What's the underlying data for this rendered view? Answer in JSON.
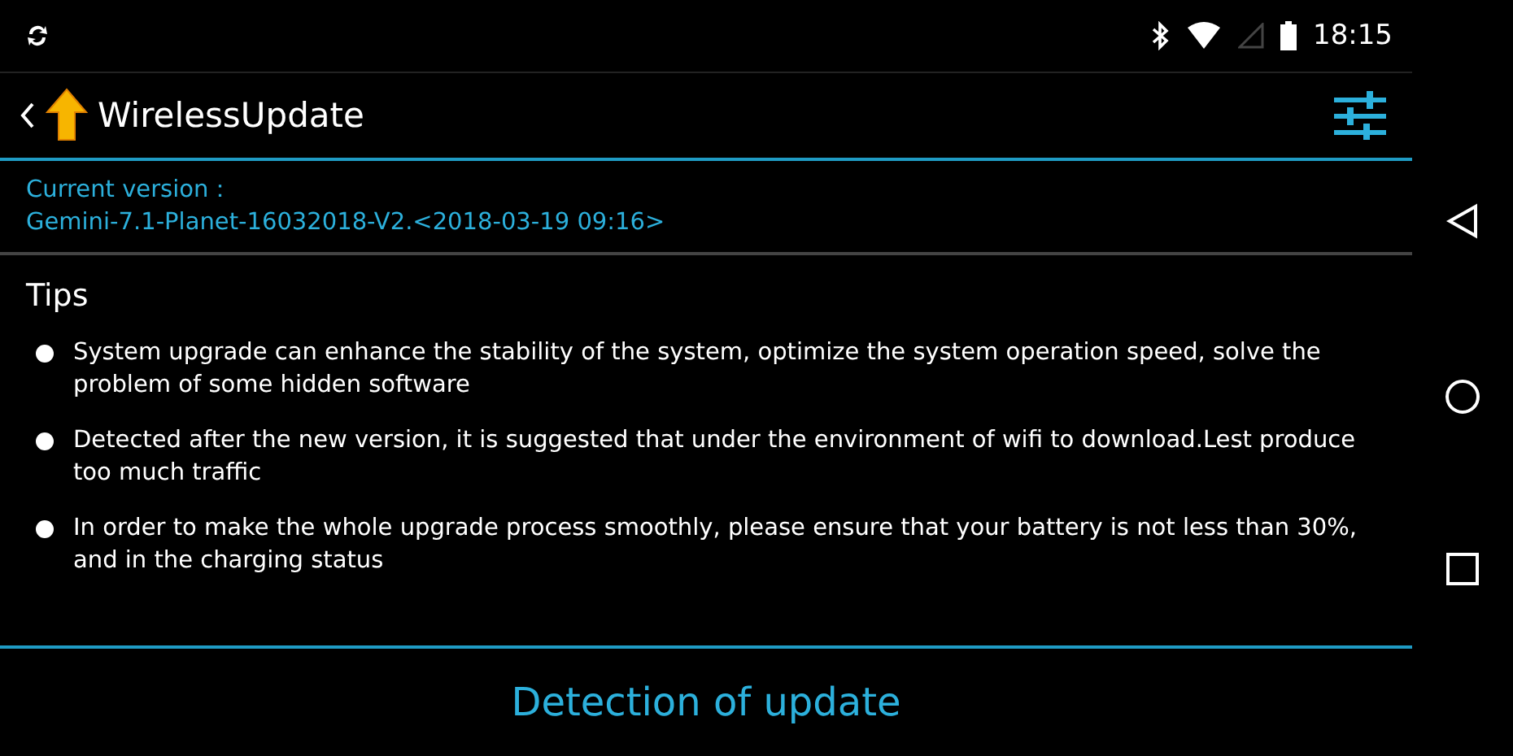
{
  "status_bar": {
    "time": "18:15"
  },
  "app_bar": {
    "title": "WirelessUpdate"
  },
  "version": {
    "label": "Current version：",
    "value": "Gemini-7.1-Planet-16032018-V2.<2018-03-19 09:16>"
  },
  "tips": {
    "heading": "Tips",
    "items": [
      "System upgrade can enhance the stability of the system, optimize the system operation speed, solve the problem of some hidden software",
      "Detected after the new version, it is suggested that under the environment of wifi to download.Lest produce too much traffic",
      "In order to make the whole upgrade process smoothly, please ensure that your battery is not less than 30%, and in the charging status"
    ]
  },
  "action_button": "Detection of update"
}
